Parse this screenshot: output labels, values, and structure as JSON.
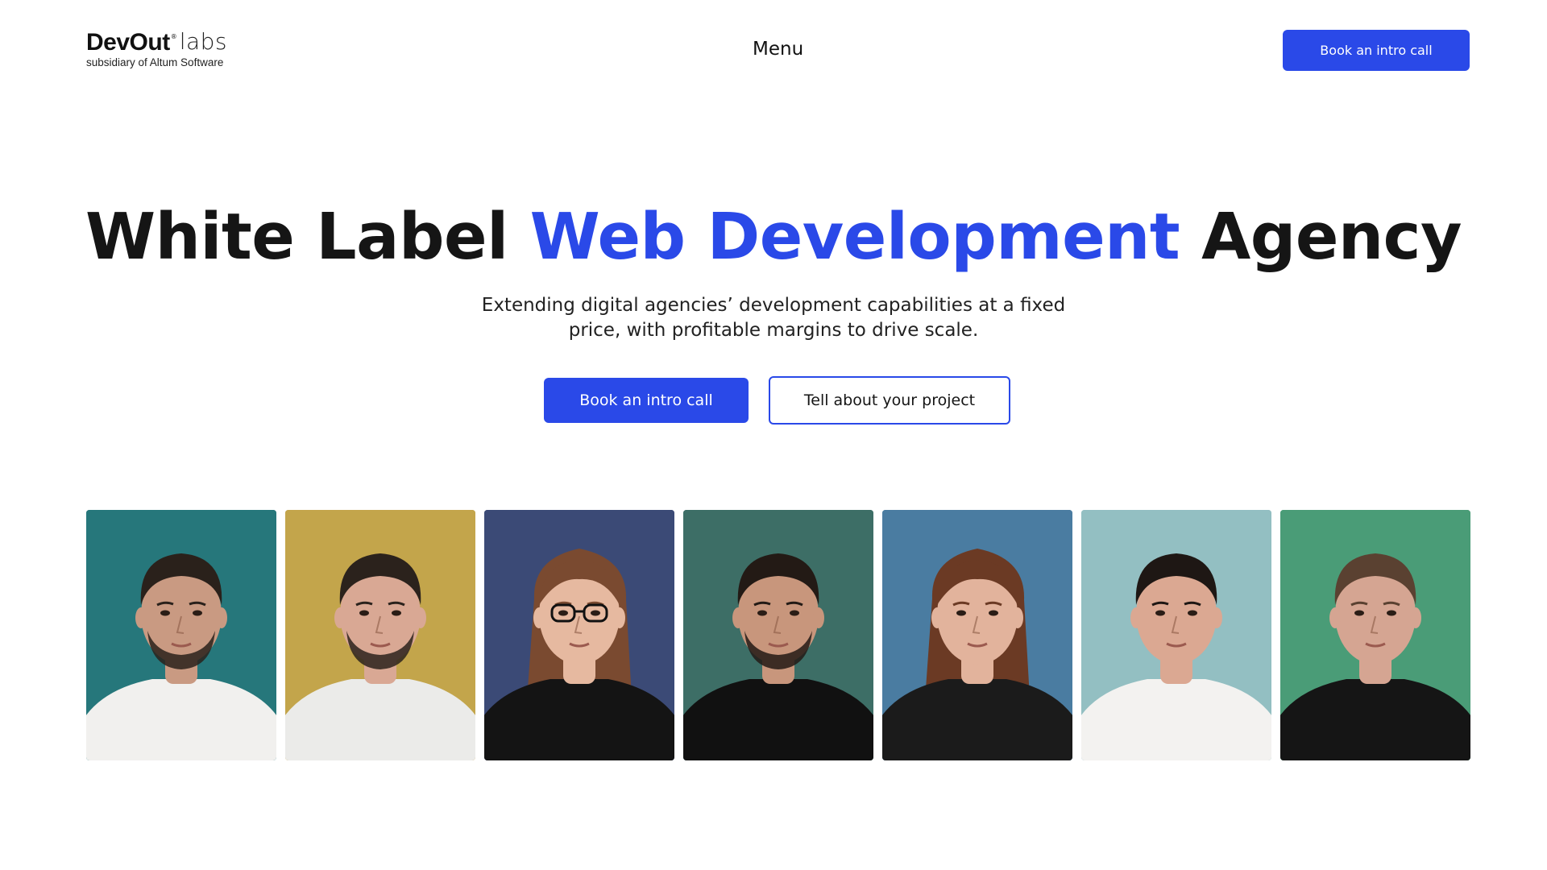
{
  "header": {
    "logo": {
      "brand": "DevOut",
      "registered": "®",
      "suffix": "labs",
      "tagline": "subsidiary of Altum Software"
    },
    "menu_label": "Menu",
    "cta_label": "Book an intro call"
  },
  "hero": {
    "title_part1": "White Label ",
    "title_accent": "Web Development",
    "title_part2": " Agency",
    "subtitle_line1": "Extending digital agencies’ development capabilities at a fixed",
    "subtitle_line2": "price, with profitable margins to drive scale.",
    "primary_cta": "Book an intro call",
    "secondary_cta": "Tell about your project"
  },
  "colors": {
    "accent": "#2a49e8",
    "text": "#151515"
  },
  "team": [
    {
      "bg": "#26777b",
      "hair": "#2a211b",
      "skin": "#c99a82",
      "shirt": "#f1f0ee",
      "beard": true,
      "long_hair": false,
      "glasses": false
    },
    {
      "bg": "#c3a54b",
      "hair": "#2b221c",
      "skin": "#d9a894",
      "shirt": "#ebebe9",
      "beard": true,
      "long_hair": false,
      "glasses": false
    },
    {
      "bg": "#3b4a76",
      "hair": "#7a4a30",
      "skin": "#e6b9a0",
      "shirt": "#141414",
      "beard": false,
      "long_hair": true,
      "glasses": true
    },
    {
      "bg": "#3d6e66",
      "hair": "#231a15",
      "skin": "#c8967c",
      "shirt": "#111111",
      "beard": true,
      "long_hair": false,
      "glasses": false
    },
    {
      "bg": "#4a7ca1",
      "hair": "#6b3a24",
      "skin": "#e2b39c",
      "shirt": "#1b1b1b",
      "beard": false,
      "long_hair": true,
      "glasses": false
    },
    {
      "bg": "#93bfc2",
      "hair": "#1e1714",
      "skin": "#dba892",
      "shirt": "#f3f2f0",
      "beard": false,
      "long_hair": false,
      "glasses": false
    },
    {
      "bg": "#4a9c77",
      "hair": "#5a4131",
      "skin": "#d5a592",
      "shirt": "#151515",
      "beard": false,
      "long_hair": false,
      "glasses": false
    }
  ]
}
